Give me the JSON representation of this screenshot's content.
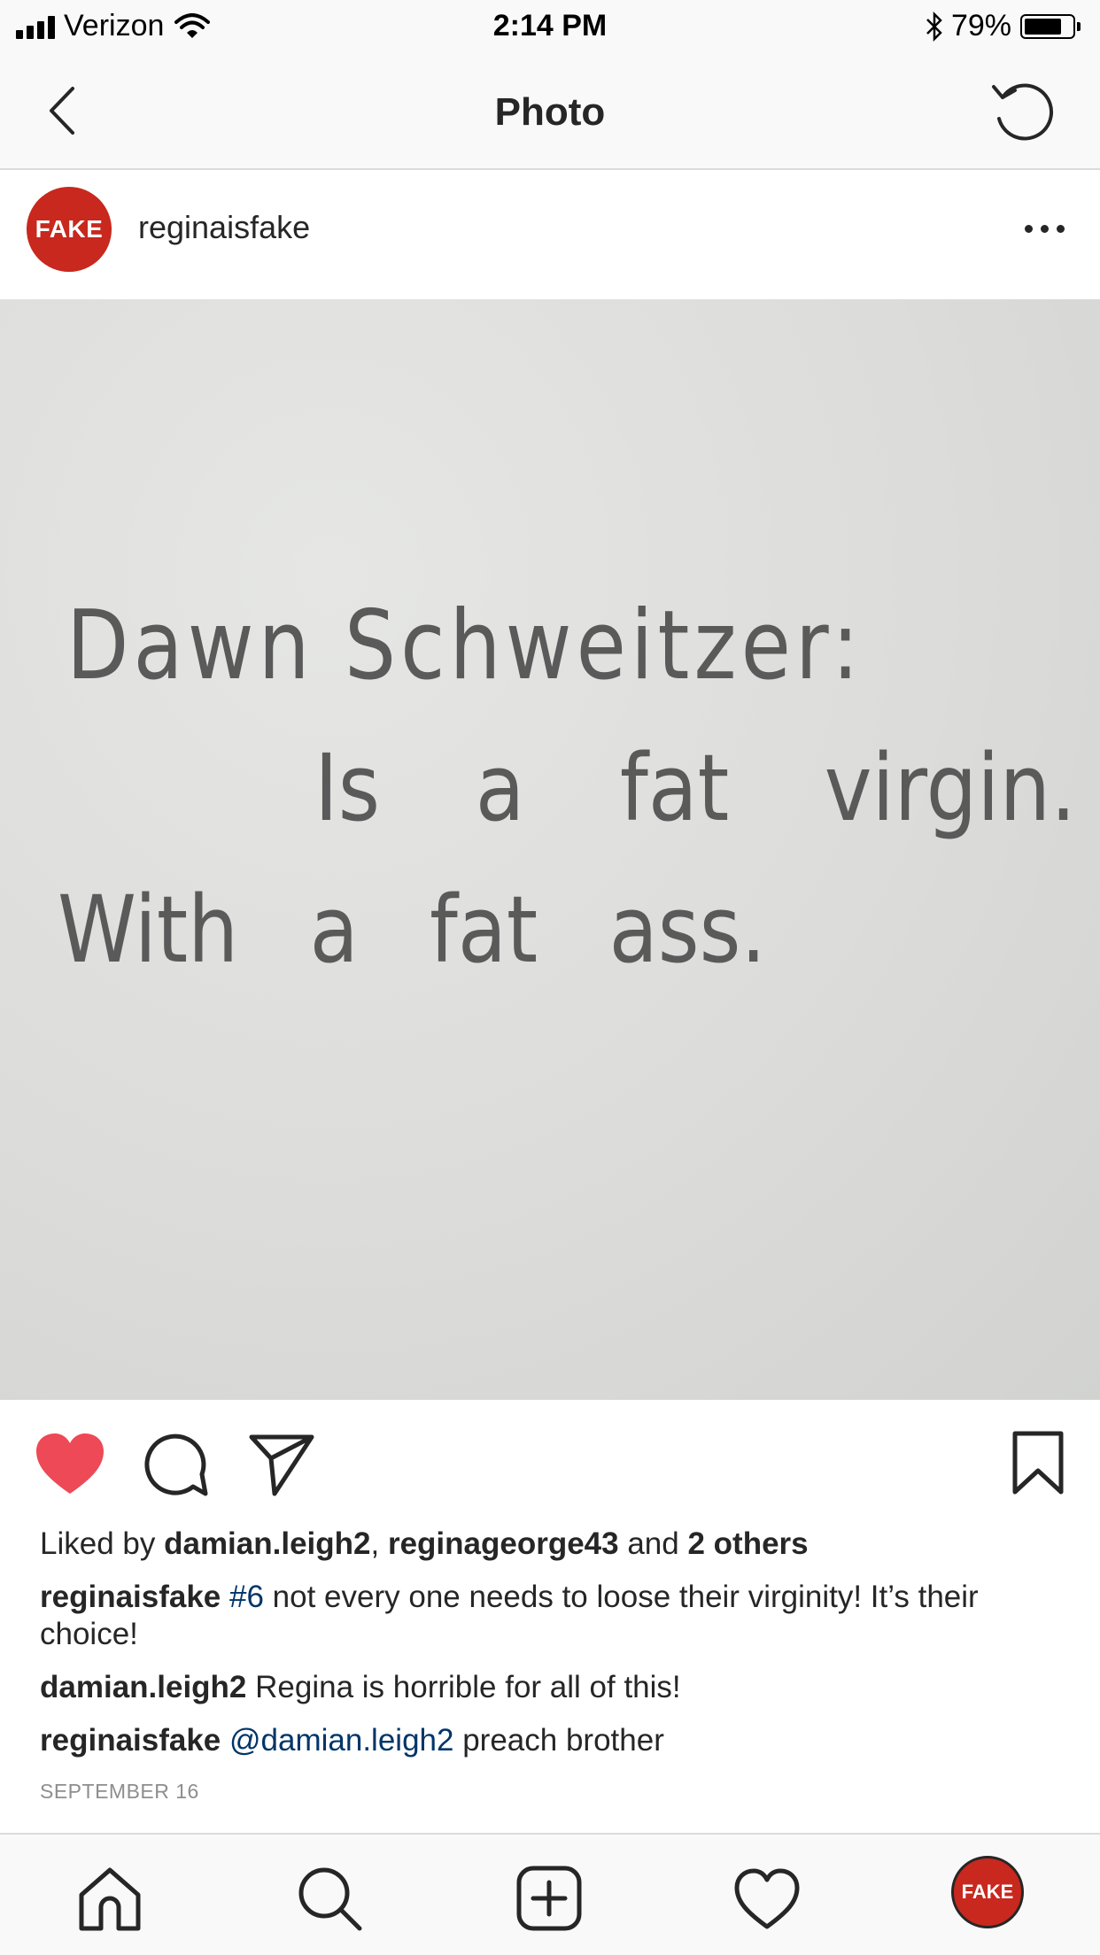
{
  "status_bar": {
    "carrier": "Verizon",
    "time": "2:14 PM",
    "battery_percent": "79%",
    "battery_level": 0.79
  },
  "nav": {
    "title": "Photo",
    "back_icon": "chevron-left-icon",
    "refresh_icon": "refresh-icon"
  },
  "post": {
    "avatar_text": "FAKE",
    "username": "reginaisfake",
    "photo": {
      "handwriting": [
        "Dawn Schweitzer:",
        "Is a fat virgin.",
        "With a fat ass."
      ]
    },
    "liked": true,
    "likes": {
      "prefix": "Liked by ",
      "user1": "damian.leigh2",
      "sep": ", ",
      "user2": "reginageorge43",
      "and": " and ",
      "others": "2 others"
    },
    "caption": {
      "user": "reginaisfake",
      "hashtag": "#6",
      "text": " not every one needs to loose their virginity! It’s their choice!"
    },
    "comments": [
      {
        "user": "damian.leigh2",
        "mention": "",
        "text": " Regina is horrible for all of this!"
      },
      {
        "user": "reginaisfake",
        "mention": "@damian.leigh2",
        "text": " preach brother"
      }
    ],
    "date": "SEPTEMBER 16"
  },
  "tab_bar": {
    "items": [
      "home-icon",
      "search-icon",
      "add-post-icon",
      "activity-icon",
      "profile-avatar"
    ],
    "profile_text": "FAKE"
  },
  "colors": {
    "like_red": "#ed4956",
    "avatar_red": "#c8281e",
    "link_blue": "#003569"
  }
}
